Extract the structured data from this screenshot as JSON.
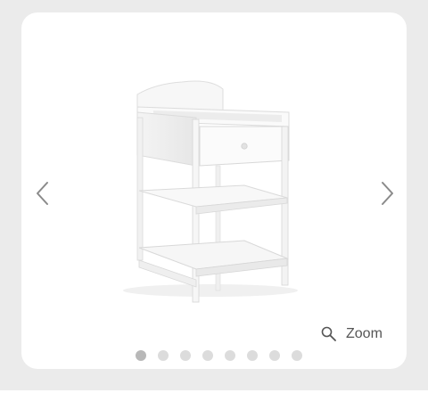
{
  "gallery": {
    "zoom_label": "Zoom",
    "total_images": 8,
    "active_index": 0,
    "icons": {
      "previous": "chevron-left-icon",
      "next": "chevron-right-icon",
      "zoom": "magnifier-icon"
    }
  }
}
